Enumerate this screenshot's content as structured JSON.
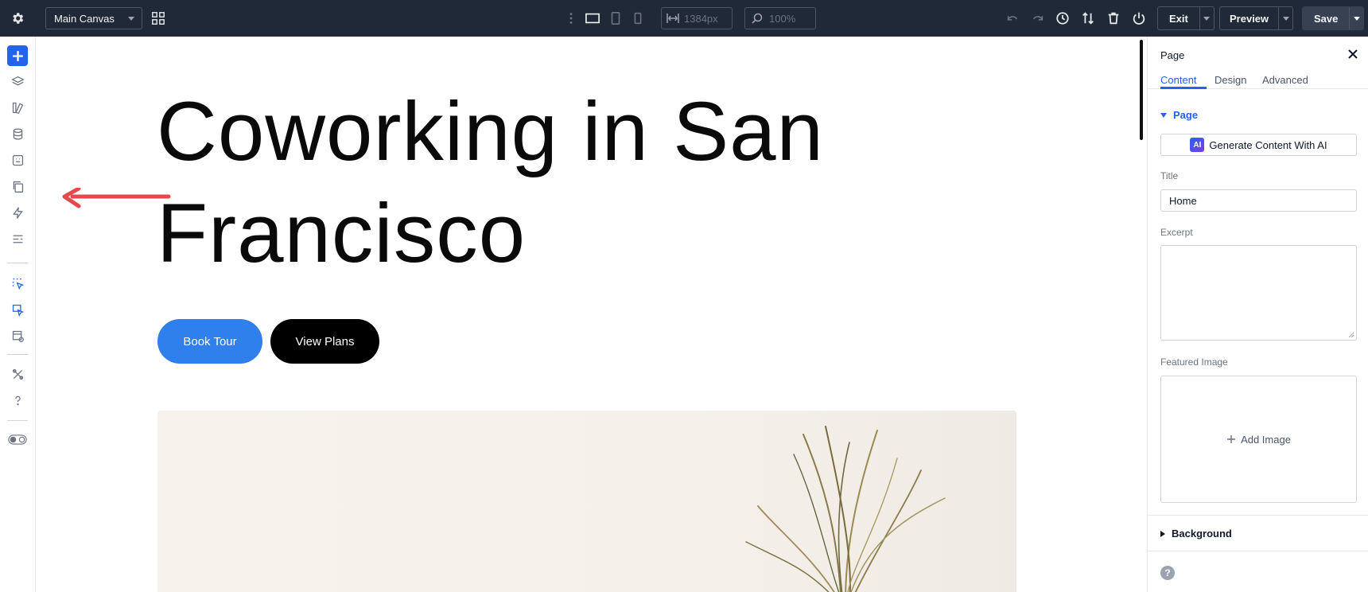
{
  "topbar": {
    "canvas_select": "Main Canvas",
    "width_value": "1384px",
    "zoom_value": "100%",
    "exit_label": "Exit",
    "preview_label": "Preview",
    "save_label": "Save"
  },
  "canvas": {
    "hero_title": "Coworking in San Francisco",
    "primary_button": "Book Tour",
    "secondary_button": "View Plans"
  },
  "panel": {
    "title": "Page",
    "tabs": [
      "Content",
      "Design",
      "Advanced"
    ],
    "active_tab": "Content",
    "section_page": "Page",
    "ai_button": "Generate Content With AI",
    "ai_badge": "AI",
    "title_label": "Title",
    "title_value": "Home",
    "excerpt_label": "Excerpt",
    "featured_image_label": "Featured Image",
    "add_image": "Add Image",
    "section_background": "Background",
    "help": "?"
  },
  "colors": {
    "topbar_bg": "#1f2937",
    "accent": "#2563eb",
    "book_tour": "#2f80ed",
    "annotation_arrow": "#e5484d"
  }
}
